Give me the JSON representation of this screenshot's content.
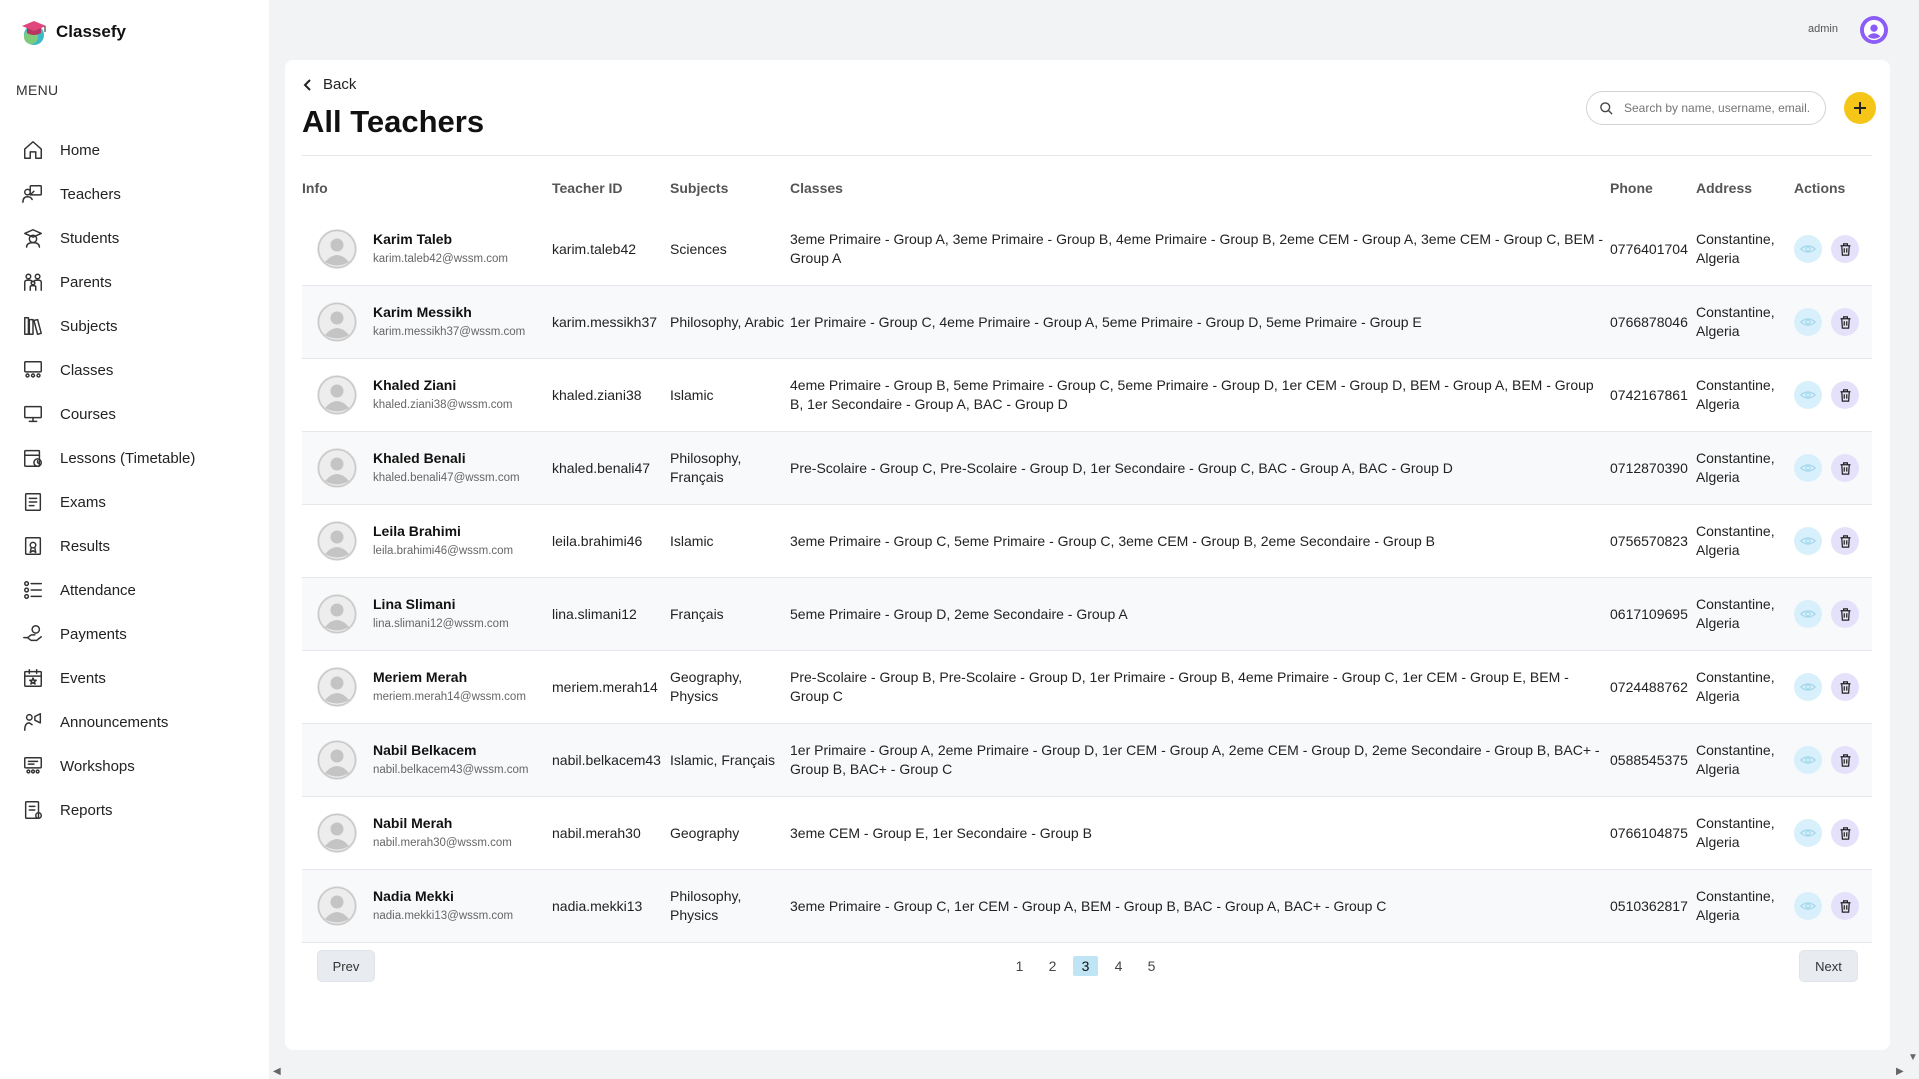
{
  "app": {
    "name": "Classefy"
  },
  "sidebar": {
    "menu_title": "MENU",
    "items": [
      {
        "label": "Home",
        "icon": "home-icon"
      },
      {
        "label": "Teachers",
        "icon": "teacher-icon"
      },
      {
        "label": "Students",
        "icon": "student-icon"
      },
      {
        "label": "Parents",
        "icon": "parents-icon"
      },
      {
        "label": "Subjects",
        "icon": "subjects-icon"
      },
      {
        "label": "Classes",
        "icon": "classes-icon"
      },
      {
        "label": "Courses",
        "icon": "courses-icon"
      },
      {
        "label": "Lessons (Timetable)",
        "icon": "timetable-icon"
      },
      {
        "label": "Exams",
        "icon": "exams-icon"
      },
      {
        "label": "Results",
        "icon": "results-icon"
      },
      {
        "label": "Attendance",
        "icon": "attendance-icon"
      },
      {
        "label": "Payments",
        "icon": "payments-icon"
      },
      {
        "label": "Events",
        "icon": "events-icon"
      },
      {
        "label": "Announcements",
        "icon": "announcements-icon"
      },
      {
        "label": "Workshops",
        "icon": "workshops-icon"
      },
      {
        "label": "Reports",
        "icon": "reports-icon"
      }
    ]
  },
  "topbar": {
    "user_label": "admin"
  },
  "page": {
    "back_label": "Back",
    "title": "All Teachers",
    "search_placeholder": "Search by name, username, email...",
    "add_button_icon": "plus-icon"
  },
  "table": {
    "headers": {
      "info": "Info",
      "teacher_id": "Teacher ID",
      "subjects": "Subjects",
      "classes": "Classes",
      "phone": "Phone",
      "address": "Address",
      "actions": "Actions"
    },
    "rows": [
      {
        "name": "Karim Taleb",
        "email": "karim.taleb42@wssm.com",
        "id": "karim.taleb42",
        "subjects": "Sciences",
        "classes": "3eme Primaire - Group A, 3eme Primaire - Group B, 4eme Primaire - Group B, 2eme CEM - Group A, 3eme CEM - Group C, BEM - Group A",
        "phone": "0776401704",
        "address": "Constantine, Algeria"
      },
      {
        "name": "Karim Messikh",
        "email": "karim.messikh37@wssm.com",
        "id": "karim.messikh37",
        "subjects": "Philosophy, Arabic",
        "classes": "1er Primaire - Group C, 4eme Primaire - Group A, 5eme Primaire - Group D, 5eme Primaire - Group E",
        "phone": "0766878046",
        "address": "Constantine, Algeria"
      },
      {
        "name": "Khaled Ziani",
        "email": "khaled.ziani38@wssm.com",
        "id": "khaled.ziani38",
        "subjects": "Islamic",
        "classes": "4eme Primaire - Group B, 5eme Primaire - Group C, 5eme Primaire - Group D, 1er CEM - Group D, BEM - Group A, BEM - Group B, 1er Secondaire - Group A, BAC - Group D",
        "phone": "0742167861",
        "address": "Constantine, Algeria"
      },
      {
        "name": "Khaled Benali",
        "email": "khaled.benali47@wssm.com",
        "id": "khaled.benali47",
        "subjects": "Philosophy, Français",
        "classes": "Pre-Scolaire - Group C, Pre-Scolaire - Group D, 1er Secondaire - Group C, BAC - Group A, BAC - Group D",
        "phone": "0712870390",
        "address": "Constantine, Algeria"
      },
      {
        "name": "Leila Brahimi",
        "email": "leila.brahimi46@wssm.com",
        "id": "leila.brahimi46",
        "subjects": "Islamic",
        "classes": "3eme Primaire - Group C, 5eme Primaire - Group C, 3eme CEM - Group B, 2eme Secondaire - Group B",
        "phone": "0756570823",
        "address": "Constantine, Algeria"
      },
      {
        "name": "Lina Slimani",
        "email": "lina.slimani12@wssm.com",
        "id": "lina.slimani12",
        "subjects": "Français",
        "classes": "5eme Primaire - Group D, 2eme Secondaire - Group A",
        "phone": "0617109695",
        "address": "Constantine, Algeria"
      },
      {
        "name": "Meriem Merah",
        "email": "meriem.merah14@wssm.com",
        "id": "meriem.merah14",
        "subjects": "Geography, Physics",
        "classes": "Pre-Scolaire - Group B, Pre-Scolaire - Group D, 1er Primaire - Group B, 4eme Primaire - Group C, 1er CEM - Group E, BEM - Group C",
        "phone": "0724488762",
        "address": "Constantine, Algeria"
      },
      {
        "name": "Nabil Belkacem",
        "email": "nabil.belkacem43@wssm.com",
        "id": "nabil.belkacem43",
        "subjects": "Islamic, Français",
        "classes": "1er Primaire - Group A, 2eme Primaire - Group D, 1er CEM - Group A, 2eme CEM - Group D, 2eme Secondaire - Group B, BAC+ - Group B, BAC+ - Group C",
        "phone": "0588545375",
        "address": "Constantine, Algeria"
      },
      {
        "name": "Nabil Merah",
        "email": "nabil.merah30@wssm.com",
        "id": "nabil.merah30",
        "subjects": "Geography",
        "classes": "3eme CEM - Group E, 1er Secondaire - Group B",
        "phone": "0766104875",
        "address": "Constantine, Algeria"
      },
      {
        "name": "Nadia Mekki",
        "email": "nadia.mekki13@wssm.com",
        "id": "nadia.mekki13",
        "subjects": "Philosophy, Physics",
        "classes": "3eme Primaire - Group C, 1er CEM - Group A, BEM - Group B, BAC - Group A, BAC+ - Group C",
        "phone": "0510362817",
        "address": "Constantine, Algeria"
      }
    ]
  },
  "pagination": {
    "prev_label": "Prev",
    "next_label": "Next",
    "pages": [
      "1",
      "2",
      "3",
      "4",
      "5"
    ],
    "current": "3"
  },
  "colors": {
    "accent_yellow": "#f5c518",
    "avatar_purple": "#8b5cf6",
    "view_bg": "#d7f0fb",
    "delete_bg": "#e6e1fa",
    "active_page": "#bfe5f5"
  }
}
